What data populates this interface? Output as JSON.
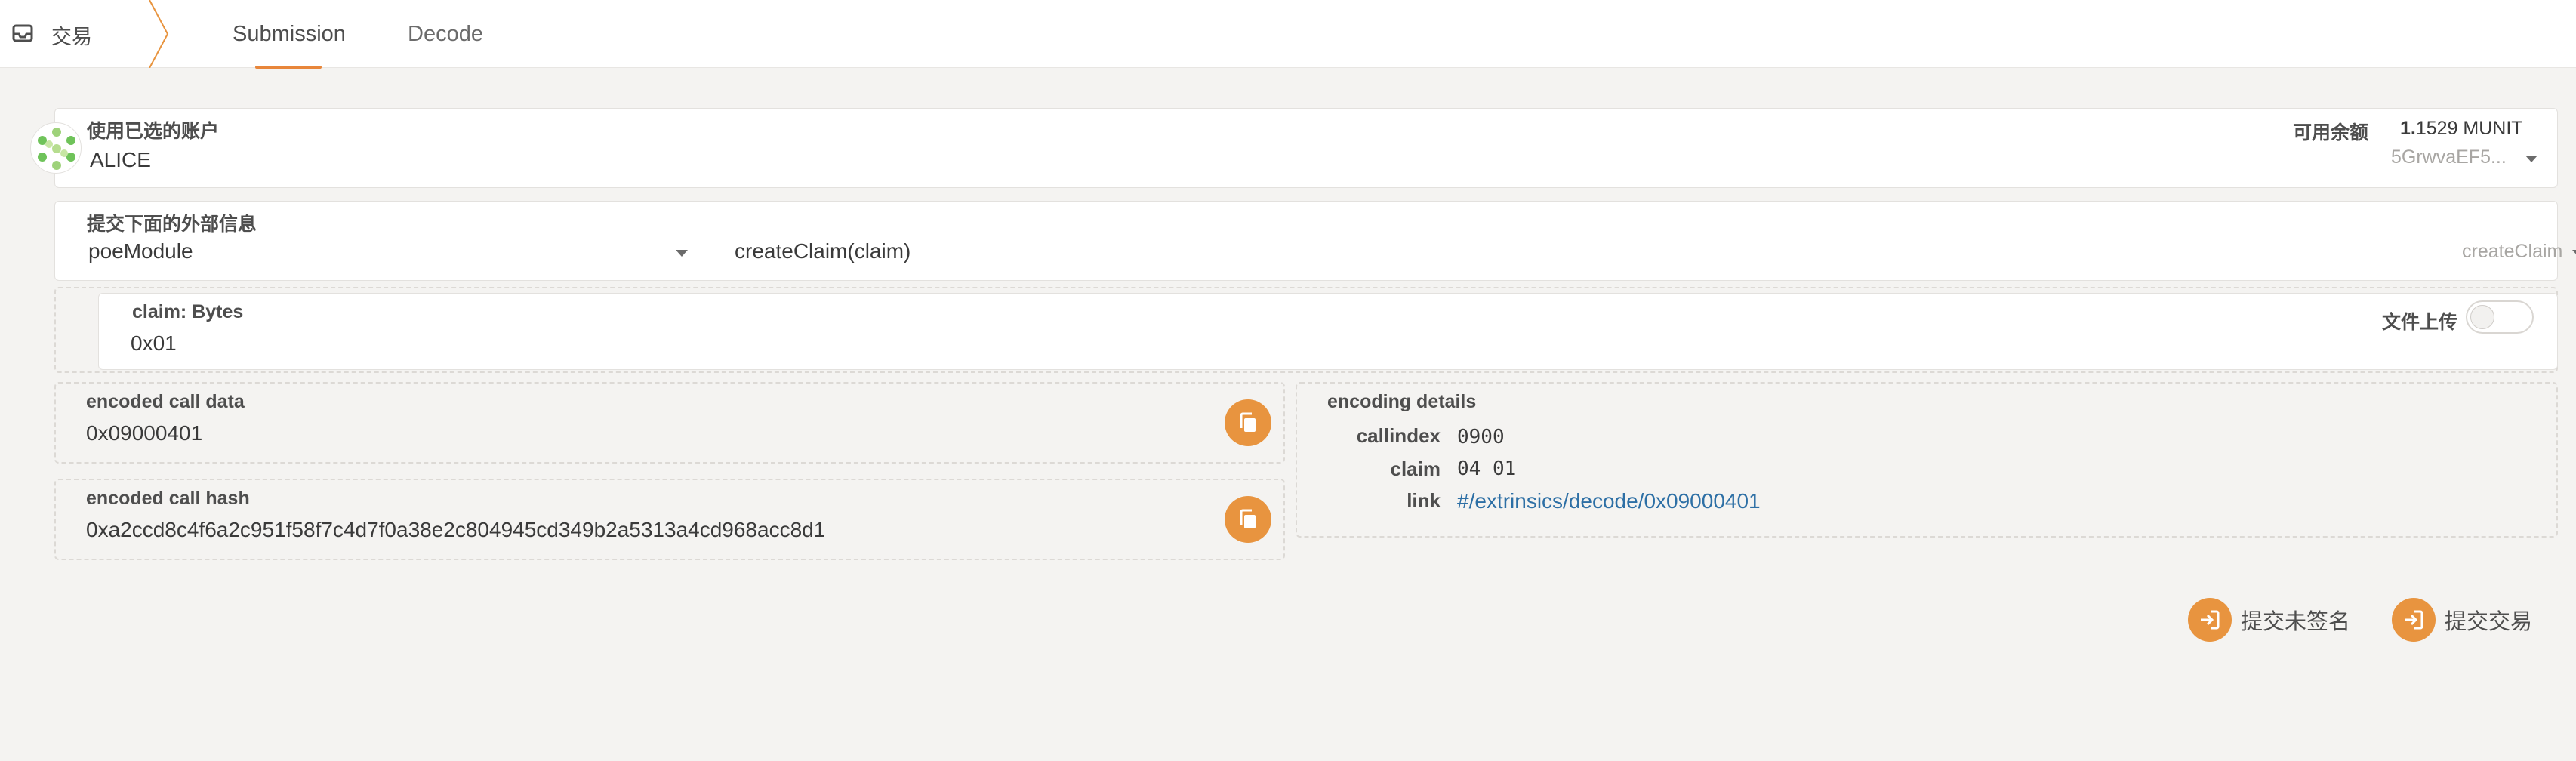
{
  "nav": {
    "app_title": "交易",
    "tabs": [
      {
        "label": "Submission"
      },
      {
        "label": "Decode"
      }
    ]
  },
  "account": {
    "label": "使用已选的账户",
    "name": "ALICE",
    "balance_label": "可用余额",
    "balance_whole": "1.",
    "balance_rest": "1529 MUNIT",
    "address_short": "5GrwvaEF5..."
  },
  "extrinsic": {
    "label": "提交下面的外部信息",
    "module": "poeModule",
    "call": "createClaim(claim)",
    "call_hint": "createClaim"
  },
  "param": {
    "label": "claim: Bytes",
    "value": "0x01",
    "file_upload_label": "文件上传"
  },
  "encoded": {
    "data_label": "encoded call data",
    "data_value": "0x09000401",
    "hash_label": "encoded call hash",
    "hash_value": "0xa2ccd8c4f6a2c951f58f7c4d7f0a38e2c804945cd349b2a5313a4cd968acc8d1"
  },
  "details": {
    "title": "encoding details",
    "callindex_key": "callindex",
    "callindex_val": "0900",
    "claim_key": "claim",
    "claim_val": "04 01",
    "link_key": "link",
    "link_val": "#/extrinsics/decode/0x09000401"
  },
  "actions": {
    "unsigned_label": "提交未签名",
    "submit_label": "提交交易"
  },
  "colors": {
    "accent": "#e8943f",
    "link": "#2d6fa5",
    "background": "#f4f3f1"
  }
}
